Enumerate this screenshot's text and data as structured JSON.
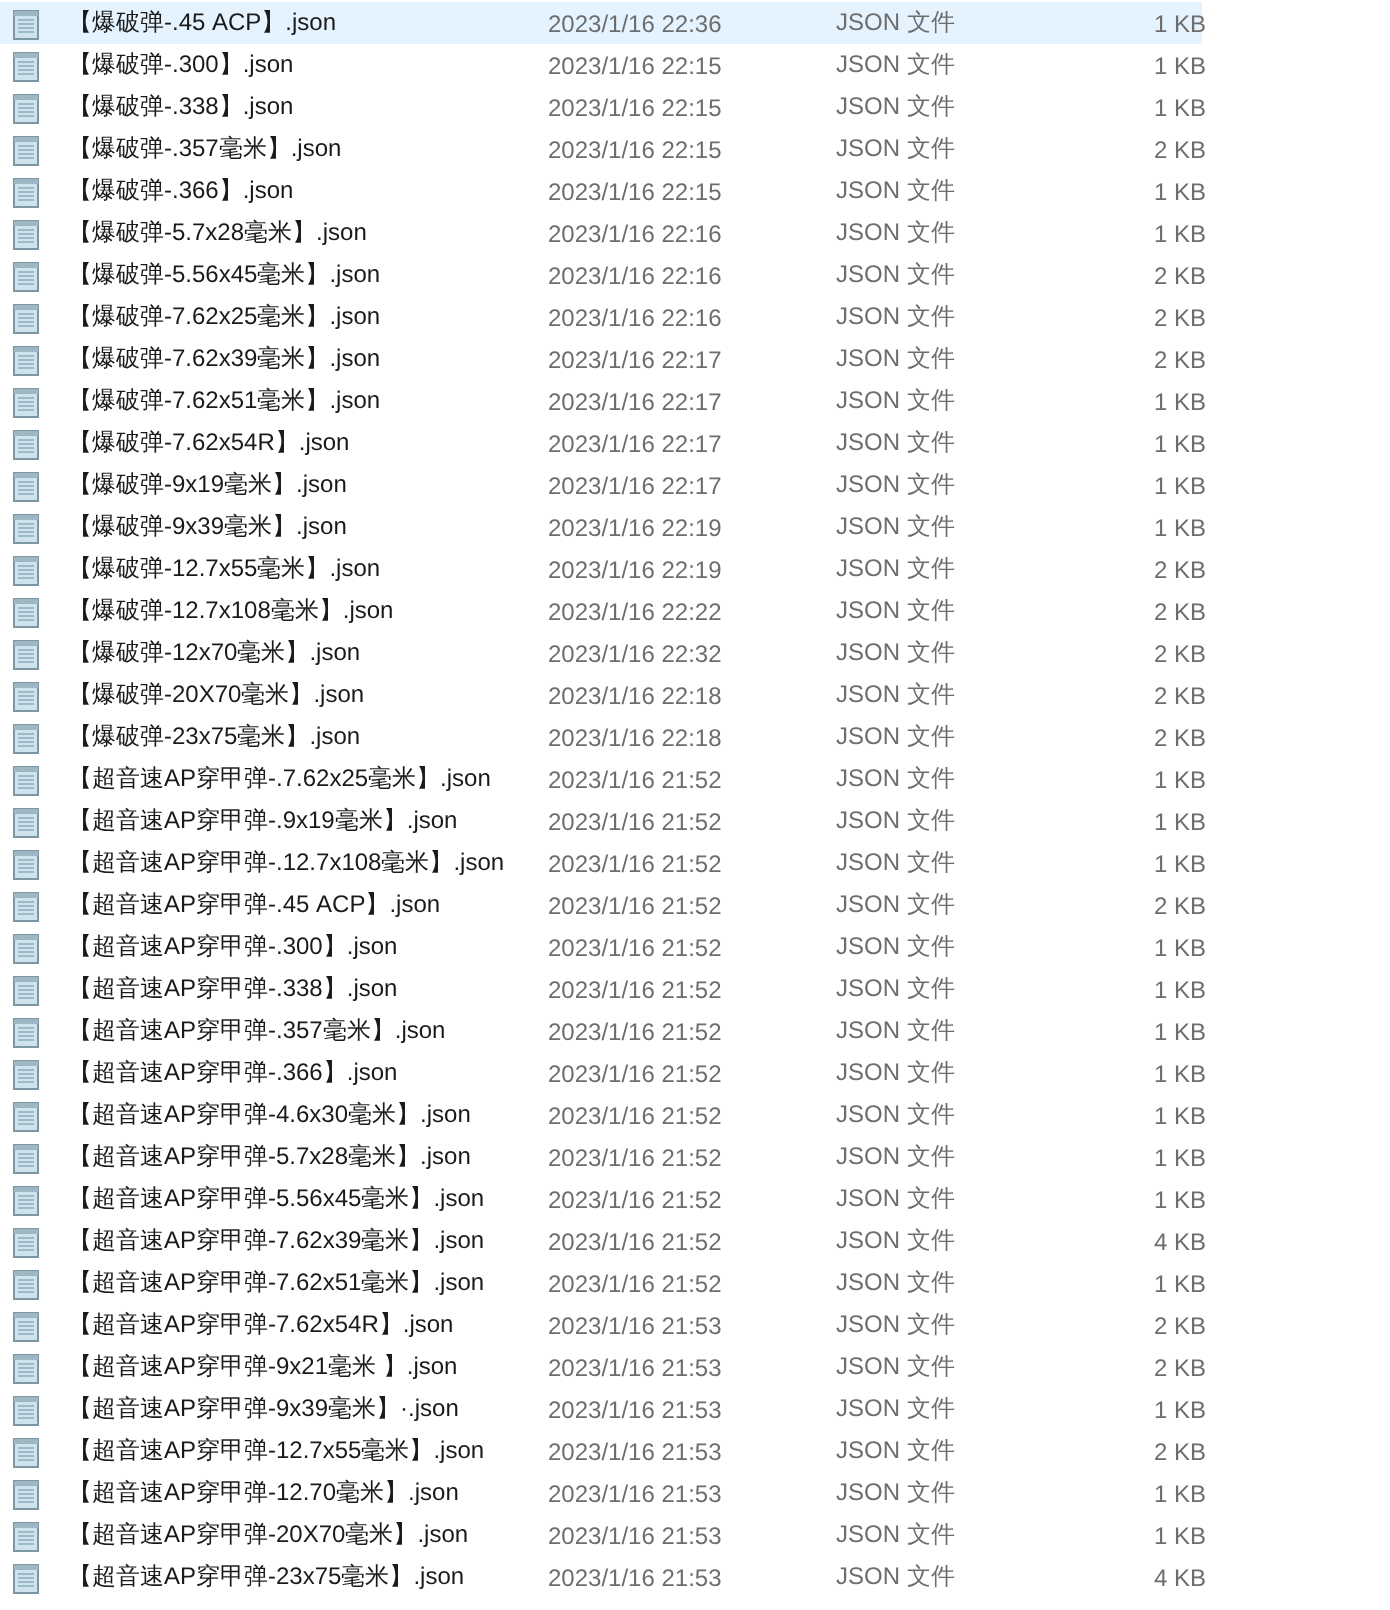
{
  "files": [
    {
      "name": "【爆破弹-.45 ACP】.json",
      "modified": "2023/1/16 22:36",
      "type": "JSON 文件",
      "size": "1 KB",
      "selected": true
    },
    {
      "name": "【爆破弹-.300】.json",
      "modified": "2023/1/16 22:15",
      "type": "JSON 文件",
      "size": "1 KB",
      "selected": false
    },
    {
      "name": "【爆破弹-.338】.json",
      "modified": "2023/1/16 22:15",
      "type": "JSON 文件",
      "size": "1 KB",
      "selected": false
    },
    {
      "name": "【爆破弹-.357毫米】.json",
      "modified": "2023/1/16 22:15",
      "type": "JSON 文件",
      "size": "2 KB",
      "selected": false
    },
    {
      "name": "【爆破弹-.366】.json",
      "modified": "2023/1/16 22:15",
      "type": "JSON 文件",
      "size": "1 KB",
      "selected": false
    },
    {
      "name": "【爆破弹-5.7x28毫米】.json",
      "modified": "2023/1/16 22:16",
      "type": "JSON 文件",
      "size": "1 KB",
      "selected": false
    },
    {
      "name": "【爆破弹-5.56x45毫米】.json",
      "modified": "2023/1/16 22:16",
      "type": "JSON 文件",
      "size": "2 KB",
      "selected": false
    },
    {
      "name": "【爆破弹-7.62x25毫米】.json",
      "modified": "2023/1/16 22:16",
      "type": "JSON 文件",
      "size": "2 KB",
      "selected": false
    },
    {
      "name": "【爆破弹-7.62x39毫米】.json",
      "modified": "2023/1/16 22:17",
      "type": "JSON 文件",
      "size": "2 KB",
      "selected": false
    },
    {
      "name": "【爆破弹-7.62x51毫米】.json",
      "modified": "2023/1/16 22:17",
      "type": "JSON 文件",
      "size": "1 KB",
      "selected": false
    },
    {
      "name": "【爆破弹-7.62x54R】.json",
      "modified": "2023/1/16 22:17",
      "type": "JSON 文件",
      "size": "1 KB",
      "selected": false
    },
    {
      "name": "【爆破弹-9x19毫米】.json",
      "modified": "2023/1/16 22:17",
      "type": "JSON 文件",
      "size": "1 KB",
      "selected": false
    },
    {
      "name": "【爆破弹-9x39毫米】.json",
      "modified": "2023/1/16 22:19",
      "type": "JSON 文件",
      "size": "1 KB",
      "selected": false
    },
    {
      "name": "【爆破弹-12.7x55毫米】.json",
      "modified": "2023/1/16 22:19",
      "type": "JSON 文件",
      "size": "2 KB",
      "selected": false
    },
    {
      "name": "【爆破弹-12.7x108毫米】.json",
      "modified": "2023/1/16 22:22",
      "type": "JSON 文件",
      "size": "2 KB",
      "selected": false
    },
    {
      "name": "【爆破弹-12x70毫米】.json",
      "modified": "2023/1/16 22:32",
      "type": "JSON 文件",
      "size": "2 KB",
      "selected": false
    },
    {
      "name": "【爆破弹-20X70毫米】.json",
      "modified": "2023/1/16 22:18",
      "type": "JSON 文件",
      "size": "2 KB",
      "selected": false
    },
    {
      "name": "【爆破弹-23x75毫米】.json",
      "modified": "2023/1/16 22:18",
      "type": "JSON 文件",
      "size": "2 KB",
      "selected": false
    },
    {
      "name": "【超音速AP穿甲弹-.7.62x25毫米】.json",
      "modified": "2023/1/16 21:52",
      "type": "JSON 文件",
      "size": "1 KB",
      "selected": false
    },
    {
      "name": "【超音速AP穿甲弹-.9x19毫米】.json",
      "modified": "2023/1/16 21:52",
      "type": "JSON 文件",
      "size": "1 KB",
      "selected": false
    },
    {
      "name": "【超音速AP穿甲弹-.12.7x108毫米】.json",
      "modified": "2023/1/16 21:52",
      "type": "JSON 文件",
      "size": "1 KB",
      "selected": false
    },
    {
      "name": "【超音速AP穿甲弹-.45 ACP】.json",
      "modified": "2023/1/16 21:52",
      "type": "JSON 文件",
      "size": "2 KB",
      "selected": false
    },
    {
      "name": "【超音速AP穿甲弹-.300】.json",
      "modified": "2023/1/16 21:52",
      "type": "JSON 文件",
      "size": "1 KB",
      "selected": false
    },
    {
      "name": "【超音速AP穿甲弹-.338】.json",
      "modified": "2023/1/16 21:52",
      "type": "JSON 文件",
      "size": "1 KB",
      "selected": false
    },
    {
      "name": "【超音速AP穿甲弹-.357毫米】.json",
      "modified": "2023/1/16 21:52",
      "type": "JSON 文件",
      "size": "1 KB",
      "selected": false
    },
    {
      "name": "【超音速AP穿甲弹-.366】.json",
      "modified": "2023/1/16 21:52",
      "type": "JSON 文件",
      "size": "1 KB",
      "selected": false
    },
    {
      "name": "【超音速AP穿甲弹-4.6x30毫米】.json",
      "modified": "2023/1/16 21:52",
      "type": "JSON 文件",
      "size": "1 KB",
      "selected": false
    },
    {
      "name": "【超音速AP穿甲弹-5.7x28毫米】.json",
      "modified": "2023/1/16 21:52",
      "type": "JSON 文件",
      "size": "1 KB",
      "selected": false
    },
    {
      "name": "【超音速AP穿甲弹-5.56x45毫米】.json",
      "modified": "2023/1/16 21:52",
      "type": "JSON 文件",
      "size": "1 KB",
      "selected": false
    },
    {
      "name": "【超音速AP穿甲弹-7.62x39毫米】.json",
      "modified": "2023/1/16 21:52",
      "type": "JSON 文件",
      "size": "4 KB",
      "selected": false
    },
    {
      "name": "【超音速AP穿甲弹-7.62x51毫米】.json",
      "modified": "2023/1/16 21:52",
      "type": "JSON 文件",
      "size": "1 KB",
      "selected": false
    },
    {
      "name": "【超音速AP穿甲弹-7.62x54R】.json",
      "modified": "2023/1/16 21:53",
      "type": "JSON 文件",
      "size": "2 KB",
      "selected": false
    },
    {
      "name": "【超音速AP穿甲弹-9x21毫米 】.json",
      "modified": "2023/1/16 21:53",
      "type": "JSON 文件",
      "size": "2 KB",
      "selected": false
    },
    {
      "name": "【超音速AP穿甲弹-9x39毫米】·.json",
      "modified": "2023/1/16 21:53",
      "type": "JSON 文件",
      "size": "1 KB",
      "selected": false
    },
    {
      "name": "【超音速AP穿甲弹-12.7x55毫米】.json",
      "modified": "2023/1/16 21:53",
      "type": "JSON 文件",
      "size": "2 KB",
      "selected": false
    },
    {
      "name": "【超音速AP穿甲弹-12.70毫米】.json",
      "modified": "2023/1/16 21:53",
      "type": "JSON 文件",
      "size": "1 KB",
      "selected": false
    },
    {
      "name": "【超音速AP穿甲弹-20X70毫米】.json",
      "modified": "2023/1/16 21:53",
      "type": "JSON 文件",
      "size": "1 KB",
      "selected": false
    },
    {
      "name": "【超音速AP穿甲弹-23x75毫米】.json",
      "modified": "2023/1/16 21:53",
      "type": "JSON 文件",
      "size": "4 KB",
      "selected": false
    }
  ]
}
